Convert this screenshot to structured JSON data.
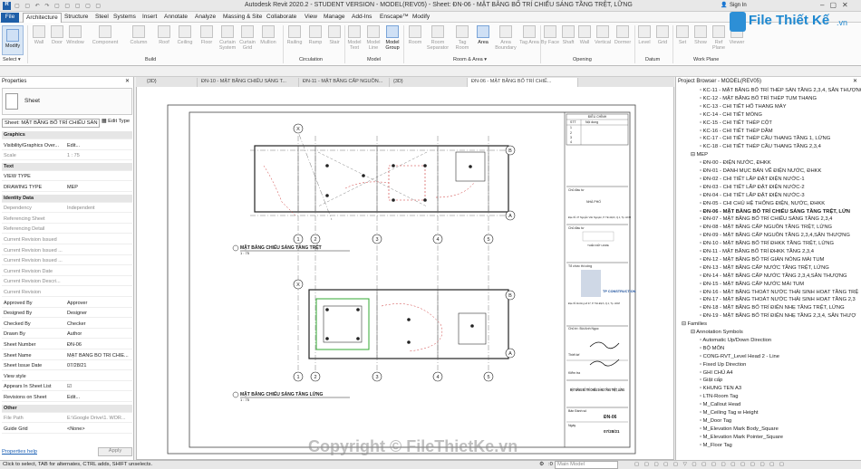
{
  "titlebar": {
    "title": "Autodesk Revit 2020.2 - STUDENT VERSION - MODEL(REV05) - Sheet: ĐN-06 - MẶT BẰNG BỐ TRÍ CHIẾU SÁNG TẦNG TRỆT, LỮNG",
    "signin": "Sign In"
  },
  "menu": [
    "File",
    "Architecture",
    "Structure",
    "Steel",
    "Systems",
    "Insert",
    "Annotate",
    "Analyze",
    "Massing & Site",
    "Collaborate",
    "View",
    "Manage",
    "Add-Ins",
    "Enscape™",
    "Modify"
  ],
  "ribbon": {
    "buttons": [
      "Modify",
      "Wall",
      "Door",
      "Window",
      "Component",
      "Column",
      "Roof",
      "Ceiling",
      "Floor",
      "Curtain System",
      "Curtain Grid",
      "Mullion",
      "Railing",
      "Ramp",
      "Stair",
      "Model Text",
      "Model Line",
      "Model Group",
      "Room",
      "Room Separator",
      "Tag Room",
      "Area",
      "Area Boundary",
      "Tag Area",
      "By Face",
      "Shaft",
      "Wall",
      "Vertical",
      "Dormer",
      "Level",
      "Grid",
      "Set",
      "Show",
      "Ref Plane",
      "Viewer"
    ],
    "groups": [
      "Select ▾",
      "Build",
      "Circulation",
      "Model",
      "Room & Area ▾",
      "Opening",
      "Datum",
      "Work Plane"
    ]
  },
  "logo": {
    "text": "File Thiết Kế",
    "suffix": ".vn"
  },
  "properties": {
    "header": "Properties",
    "type": "Sheet",
    "selector": "Sheet: MẶT BẰNG BỐ TRÍ CHIẾU SÁN",
    "edit_type": "Edit Type",
    "rows": [
      {
        "k": "Graphics",
        "v": "",
        "sec": true
      },
      {
        "k": "Visibility/Graphics Over...",
        "v": "Edit...",
        "grey": false
      },
      {
        "k": "Scale",
        "v": "1 : 75",
        "grey": true
      },
      {
        "k": "Text",
        "v": "",
        "sec": true
      },
      {
        "k": "VIEW TYPE",
        "v": "",
        "grey": false
      },
      {
        "k": "DRAWING TYPE",
        "v": "MEP",
        "grey": false
      },
      {
        "k": "Identity Data",
        "v": "",
        "sec": true
      },
      {
        "k": "Dependency",
        "v": "Independent",
        "grey": true
      },
      {
        "k": "Referencing Sheet",
        "v": "",
        "grey": true
      },
      {
        "k": "Referencing Detail",
        "v": "",
        "grey": true
      },
      {
        "k": "Current Revision Issued",
        "v": "",
        "grey": true
      },
      {
        "k": "Current Revision Issued ...",
        "v": "",
        "grey": true
      },
      {
        "k": "Current Revision Issued ...",
        "v": "",
        "grey": true
      },
      {
        "k": "Current Revision Date",
        "v": "",
        "grey": true
      },
      {
        "k": "Current Revision Descri...",
        "v": "",
        "grey": true
      },
      {
        "k": "Current Revision",
        "v": "",
        "grey": true
      },
      {
        "k": "Approved By",
        "v": "Approver",
        "grey": false
      },
      {
        "k": "Designed By",
        "v": "Designer",
        "grey": false
      },
      {
        "k": "Checked By",
        "v": "Checker",
        "grey": false
      },
      {
        "k": "Drawn By",
        "v": "Author",
        "grey": false
      },
      {
        "k": "Sheet Number",
        "v": "ĐN-06",
        "grey": false
      },
      {
        "k": "Sheet Name",
        "v": "MẶT BẰNG BỐ TRÍ CHIẾ...",
        "grey": false
      },
      {
        "k": "Sheet Issue Date",
        "v": "07/28/21",
        "grey": false
      },
      {
        "k": "View style",
        "v": "",
        "grey": false
      },
      {
        "k": "Appears In Sheet List",
        "v": "☑",
        "grey": false
      },
      {
        "k": "Revisions on Sheet",
        "v": "Edit...",
        "grey": false
      },
      {
        "k": "Other",
        "v": "",
        "sec": true
      },
      {
        "k": "File Path",
        "v": "E:\\Google Drive\\1. WOR...",
        "grey": true
      },
      {
        "k": "Guide Grid",
        "v": "<None>",
        "grey": false
      }
    ],
    "help": "Properties help",
    "apply": "Apply"
  },
  "view_tabs": [
    "{3D}",
    "ĐN-10 - MẶT BẰNG CHIẾU SÁNG T...",
    "ĐN-11 - MẶT BẰNG CẤP NGUỒN...",
    "{3D}",
    "ĐN-06 - MẶT BẰNG BỐ TRÍ CHIẾ..."
  ],
  "sheet": {
    "plan1_title": "MẶT BẰNG CHIẾU SÁNG TẦNG TRỆT",
    "plan1_scale": "1 : 75",
    "plan2_title": "MẶT BẰNG CHIẾU SÁNG TẦNG LỬNG",
    "plan2_scale": "1 : 75",
    "grid_labels_h": [
      "1",
      "2",
      "3",
      "4",
      "5"
    ],
    "grid_labels_v": [
      "B",
      "A"
    ],
    "grid_x": "X",
    "revision_header": "ĐIỀU CHỈNH",
    "revision_cols": [
      "STT",
      "Nội dung"
    ],
    "revision_rows": [
      "1",
      "2",
      "3",
      "4"
    ],
    "owner_label": "Chủ đầu tư",
    "owner_value": "NHÀ PHỐ",
    "address": "Địa chỉ: 27 Nguyễn Văn Nguyên, P. Tân Định, Q.1, Tp. HCM",
    "design_label": "Chủ đầu tư",
    "design_brand": "THIÊN KẾT HOME",
    "constructor_label": "Tổ chức thi công",
    "constructor_brand": "TP CONSTRUCTION",
    "constructor_addr": "Địa chỉ: Đường số 27, P. Tân Định, Q.1, Tp. HCM",
    "manager_label": "Chủ trì: Bùi Anh Ngọc",
    "design_role": "Thiết kế",
    "check_role": "Kiểm tra",
    "drawing_title": "MẶT BẰNG BỐ TRÍ CHIẾU SÁNG TẦNG TRỆT, LỬNG",
    "sheet_no_label": "Bản Đánh số",
    "sheet_no": "ĐN-06",
    "date_label": "Ngày",
    "date": "07/28/21"
  },
  "browser": {
    "header": "Project Browser - MODEL(REV05)",
    "items": [
      {
        "t": "KC-11 - MẶT BẰNG BỐ TRÍ THÉP SÀN TẦNG 2,3,4, SÂN THƯỢNG",
        "l": 2
      },
      {
        "t": "KC-12 - MẶT BẰNG BỐ TRÍ THÉP TUM THANG",
        "l": 2
      },
      {
        "t": "KC-13 - CHI TIẾT HỐ THANG MÁY",
        "l": 2
      },
      {
        "t": "KC-14 - CHI TIẾT MÓNG",
        "l": 2
      },
      {
        "t": "KC-15 - CHI TIẾT THÉP CỘT",
        "l": 2
      },
      {
        "t": "KC-16 - CHI TIẾT THÉP DẦM",
        "l": 2
      },
      {
        "t": "KC-17 - CHI TIẾT THÉP CẦU THANG TẦNG 1, LỬNG",
        "l": 2
      },
      {
        "t": "KC-18 - CHI TIẾT THÉP CẦU THANG TẦNG 2,3,4",
        "l": 2
      },
      {
        "t": "MEP",
        "l": 1
      },
      {
        "t": "ĐN-00 - ĐIỆN NƯỚC, ĐHKK",
        "l": 2
      },
      {
        "t": "ĐN-01 - DANH MỤC BẢN VẼ ĐIỆN NƯỚC, ĐHKK",
        "l": 2
      },
      {
        "t": "ĐN-02 - CHI TIẾT LẮP ĐẶT ĐIỆN NƯỚC-1",
        "l": 2
      },
      {
        "t": "ĐN-03 - CHI TIẾT LẮP ĐẶT ĐIỆN NƯỚC-2",
        "l": 2
      },
      {
        "t": "ĐN-04 - CHI TIẾT LẮP ĐẶT ĐIỆN NƯỚC-3",
        "l": 2
      },
      {
        "t": "ĐN-05 - CHI CHÚ HỆ THỐNG ĐIỆN, NƯỚC, ĐHKK",
        "l": 2
      },
      {
        "t": "ĐN-06 - MẶT BẰNG BỐ TRÍ CHIẾU SÁNG TẦNG TRỆT, LỬN",
        "l": 2,
        "active": true
      },
      {
        "t": "ĐN-07 - MẶT BẰNG BỐ TRÍ CHIẾU SÁNG TẦNG 2,3,4",
        "l": 2
      },
      {
        "t": "ĐN-08 - MẶT BẰNG CẤP NGUỒN TẦNG TRỆT, LỬNG",
        "l": 2
      },
      {
        "t": "ĐN-09 - MẶT BẰNG CẤP NGUỒN TẦNG 2,3,4,SÂN THƯỢNG",
        "l": 2
      },
      {
        "t": "ĐN-10 - MẶT BẰNG BỐ TRÍ ĐHKK TẦNG TRỆT, LỬNG",
        "l": 2
      },
      {
        "t": "ĐN-11 - MẶT BẰNG BỐ TRÍ ĐHKK TẦNG 2,3,4",
        "l": 2
      },
      {
        "t": "ĐN-12 - MẶT BẰNG BỐ TRÍ GIÀN NÓNG MÁI TUM",
        "l": 2
      },
      {
        "t": "ĐN-13 - MẶT BẰNG CẤP NƯỚC TẦNG TRỆT, LỬNG",
        "l": 2
      },
      {
        "t": "ĐN-14 - MẶT BẰNG CẤP NƯỚC TẦNG 2,3,4,SÂN THƯỢNG",
        "l": 2
      },
      {
        "t": "ĐN-15 - MẶT BẰNG CẤP NƯỚC MÁI TUM",
        "l": 2
      },
      {
        "t": "ĐN-16 - MẶT BẰNG THOÁT NƯỚC THẢI SINH HOẠT TẦNG TRỆ",
        "l": 2
      },
      {
        "t": "ĐN-17 - MẶT BẰNG THOÁT NƯỚC THẢI SINH HOẠT TẦNG 2,3",
        "l": 2
      },
      {
        "t": "ĐN-18 - MẶT BẰNG BỐ TRÍ ĐIỆN NHẸ TẦNG TRỆT, LỬNG",
        "l": 2
      },
      {
        "t": "ĐN-19 - MẶT BẰNG BỐ TRÍ ĐIỆN NHẸ TẦNG 2,3,4, SÂN THƯỢ",
        "l": 2
      },
      {
        "t": "Families",
        "l": 0
      },
      {
        "t": "Annotation Symbols",
        "l": 1
      },
      {
        "t": "Automatic Up/Down Direction",
        "l": 2
      },
      {
        "t": "BỘ MÔN",
        "l": 2
      },
      {
        "t": "CONG-RVT_Level Head 2 - Line",
        "l": 2
      },
      {
        "t": "Fixed Up Direction",
        "l": 2
      },
      {
        "t": "GHI CHÚ A4",
        "l": 2
      },
      {
        "t": "Giật cấp",
        "l": 2
      },
      {
        "t": "KHUNG TEN A3",
        "l": 2
      },
      {
        "t": "LTN-Room Tag",
        "l": 2
      },
      {
        "t": "M_Callout Head",
        "l": 2
      },
      {
        "t": "M_Ceiling Tag w Height",
        "l": 2
      },
      {
        "t": "M_Door Tag",
        "l": 2
      },
      {
        "t": "M_Elevation Mark Body_Square",
        "l": 2
      },
      {
        "t": "M_Elevation Mark Pointer_Square",
        "l": 2
      },
      {
        "t": "M_Floor Tag",
        "l": 2
      }
    ]
  },
  "status": {
    "hint": "Click to select, TAB for alternates, CTRL adds, SHIFT unselects.",
    "model": "Main Model",
    "zero": ":0"
  },
  "watermark": "Copyright © FileThietKe.vn"
}
